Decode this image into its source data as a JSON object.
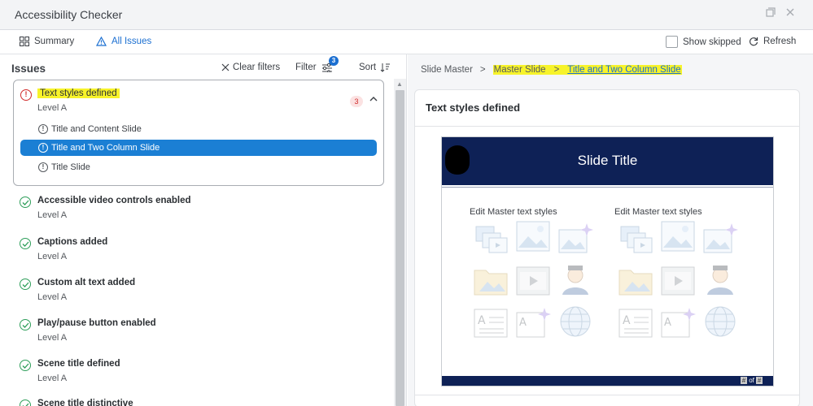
{
  "window": {
    "title": "Accessibility Checker"
  },
  "toolbar": {
    "summary_label": "Summary",
    "all_issues_label": "All Issues",
    "show_skipped_label": "Show skipped",
    "refresh_label": "Refresh"
  },
  "issues_panel": {
    "header": "Issues",
    "clear_filters_label": "Clear filters",
    "filter_label": "Filter",
    "filter_count": "3",
    "sort_label": "Sort"
  },
  "expanded_issue": {
    "title": "Text styles defined",
    "level": "Level A",
    "count": "3",
    "items": [
      {
        "label": "Title and Content Slide",
        "selected": false
      },
      {
        "label": "Title and Two Column Slide",
        "selected": true
      },
      {
        "label": "Title Slide",
        "selected": false
      }
    ]
  },
  "passed_issues": [
    {
      "title": "Accessible video controls enabled",
      "level": "Level A"
    },
    {
      "title": "Captions added",
      "level": "Level A"
    },
    {
      "title": "Custom alt text added",
      "level": "Level A"
    },
    {
      "title": "Play/pause button enabled",
      "level": "Level A"
    },
    {
      "title": "Scene title defined",
      "level": "Level A"
    },
    {
      "title": "Scene title distinctive",
      "level": ""
    }
  ],
  "breadcrumb": {
    "root": "Slide Master",
    "middle": "Master Slide",
    "current": "Title and Two Column Slide"
  },
  "detail": {
    "title": "Text styles defined",
    "slide": {
      "title": "Slide Title",
      "col1_text": "Edit Master text styles",
      "col2_text": "Edit Master text styles",
      "page_current": "#",
      "page_of": "of",
      "page_total": "#"
    }
  },
  "colors": {
    "accent": "#1b6fd1",
    "selected_bg": "#1b7fd4",
    "error": "#d12b2b",
    "success": "#2e9e5a",
    "highlight": "#f7f32a",
    "slide_navy": "#0e2156"
  }
}
